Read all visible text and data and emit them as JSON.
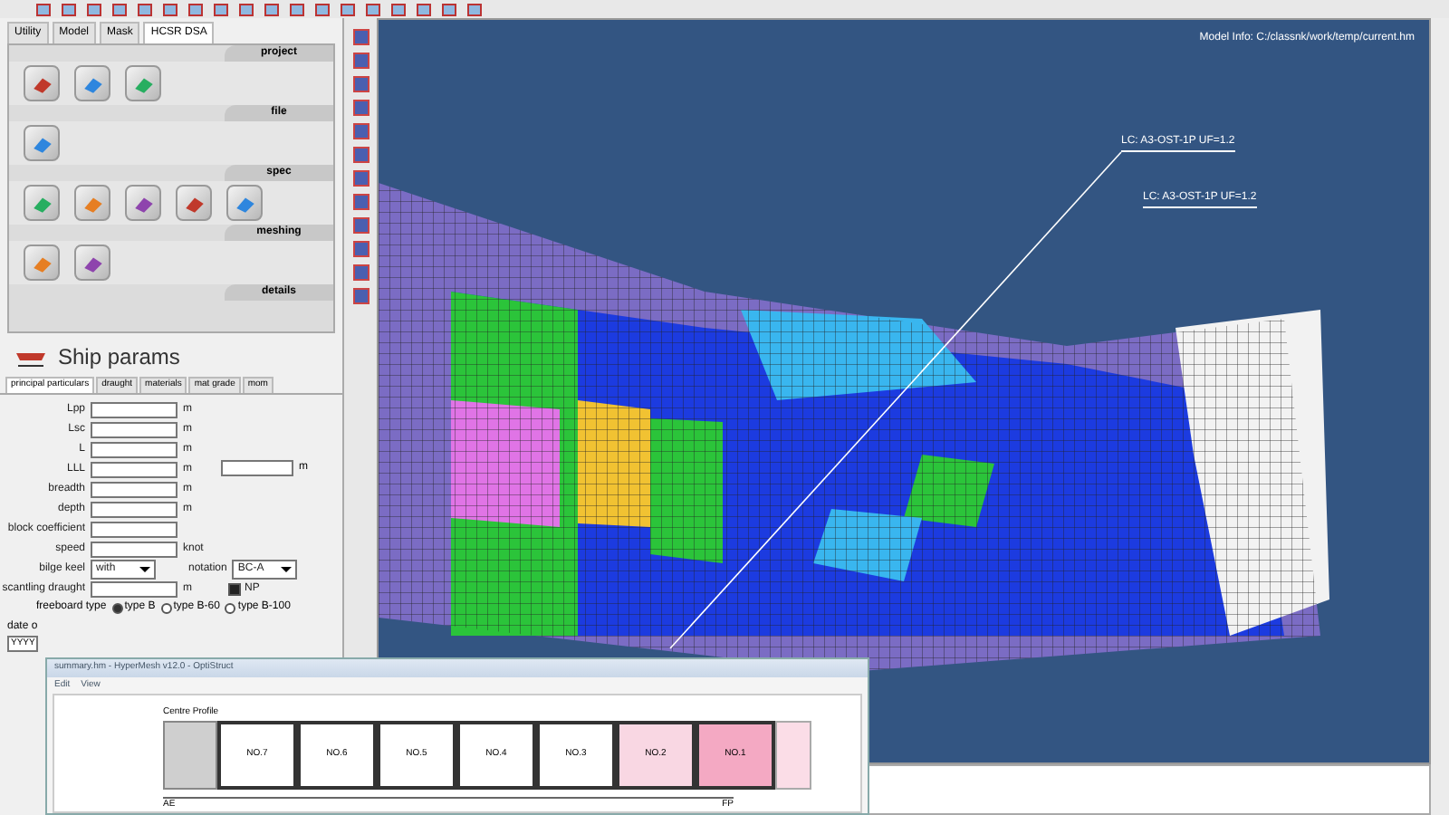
{
  "tool_tabs": [
    {
      "label": "Utility",
      "selected": false
    },
    {
      "label": "Model",
      "selected": false
    },
    {
      "label": "Mask",
      "selected": false
    },
    {
      "label": "HCSR DSA",
      "selected": true
    }
  ],
  "sections": [
    {
      "title": "project"
    },
    {
      "title": "file"
    },
    {
      "title": "spec"
    },
    {
      "title": "meshing"
    },
    {
      "title": "details"
    }
  ],
  "params": {
    "title": "Ship params",
    "tabs": [
      {
        "label": "principal particulars",
        "selected": true
      },
      {
        "label": "draught",
        "selected": false
      },
      {
        "label": "materials",
        "selected": false
      },
      {
        "label": "mat grade",
        "selected": false
      },
      {
        "label": "mom",
        "selected": false
      }
    ],
    "fields": [
      {
        "kind": "text",
        "label": "Lpp",
        "unit": "m"
      },
      {
        "kind": "text",
        "label": "Lsc",
        "unit": "m"
      },
      {
        "kind": "text",
        "label": "L",
        "unit": "m"
      },
      {
        "kind": "text",
        "label": "LLL",
        "unit": "m"
      },
      {
        "kind": "text",
        "label": "breadth",
        "unit": "m"
      },
      {
        "kind": "text",
        "label": "depth",
        "unit": "m"
      },
      {
        "kind": "text",
        "label": "block coefficient"
      },
      {
        "kind": "text",
        "label": "speed",
        "unit": "knot"
      },
      {
        "kind": "select",
        "label": "bilge keel",
        "value": "with",
        "label2": "notation",
        "value2": "BC-A"
      },
      {
        "kind": "text",
        "label": "scantling draught",
        "unit": "m",
        "check_label": "NP",
        "checked": true
      }
    ],
    "side_unit": "m",
    "freeboard": {
      "label": "freeboard type",
      "options": [
        {
          "label": "type B",
          "selected": true
        },
        {
          "label": "type B-60",
          "selected": false
        },
        {
          "label": "type B-100",
          "selected": false
        }
      ]
    },
    "date_label": "date o",
    "date_value": "YYYY"
  },
  "viewport": {
    "model_info": "Model Info: C:/classnk/work/temp/current.hm",
    "callouts": [
      "LC: A3-OST-1P UF=1.2",
      "LC: A3-OST-1P UF=1.2"
    ]
  },
  "sub_window": {
    "title": "summary.hm - HyperMesh v12.0 - OptiStruct",
    "menu": [
      "Edit",
      "View"
    ],
    "profile_label": "Centre Profile",
    "tanks": [
      {
        "label": "NO.7",
        "color": "#ffffff"
      },
      {
        "label": "NO.6",
        "color": "#ffffff"
      },
      {
        "label": "NO.5",
        "color": "#ffffff"
      },
      {
        "label": "NO.4",
        "color": "#ffffff"
      },
      {
        "label": "NO.3",
        "color": "#ffffff"
      },
      {
        "label": "NO.2",
        "color": "#f9d7e3"
      },
      {
        "label": "NO.1",
        "color": "#f4a9c3"
      }
    ],
    "aft_label": "AE",
    "fore_label": "FP"
  }
}
